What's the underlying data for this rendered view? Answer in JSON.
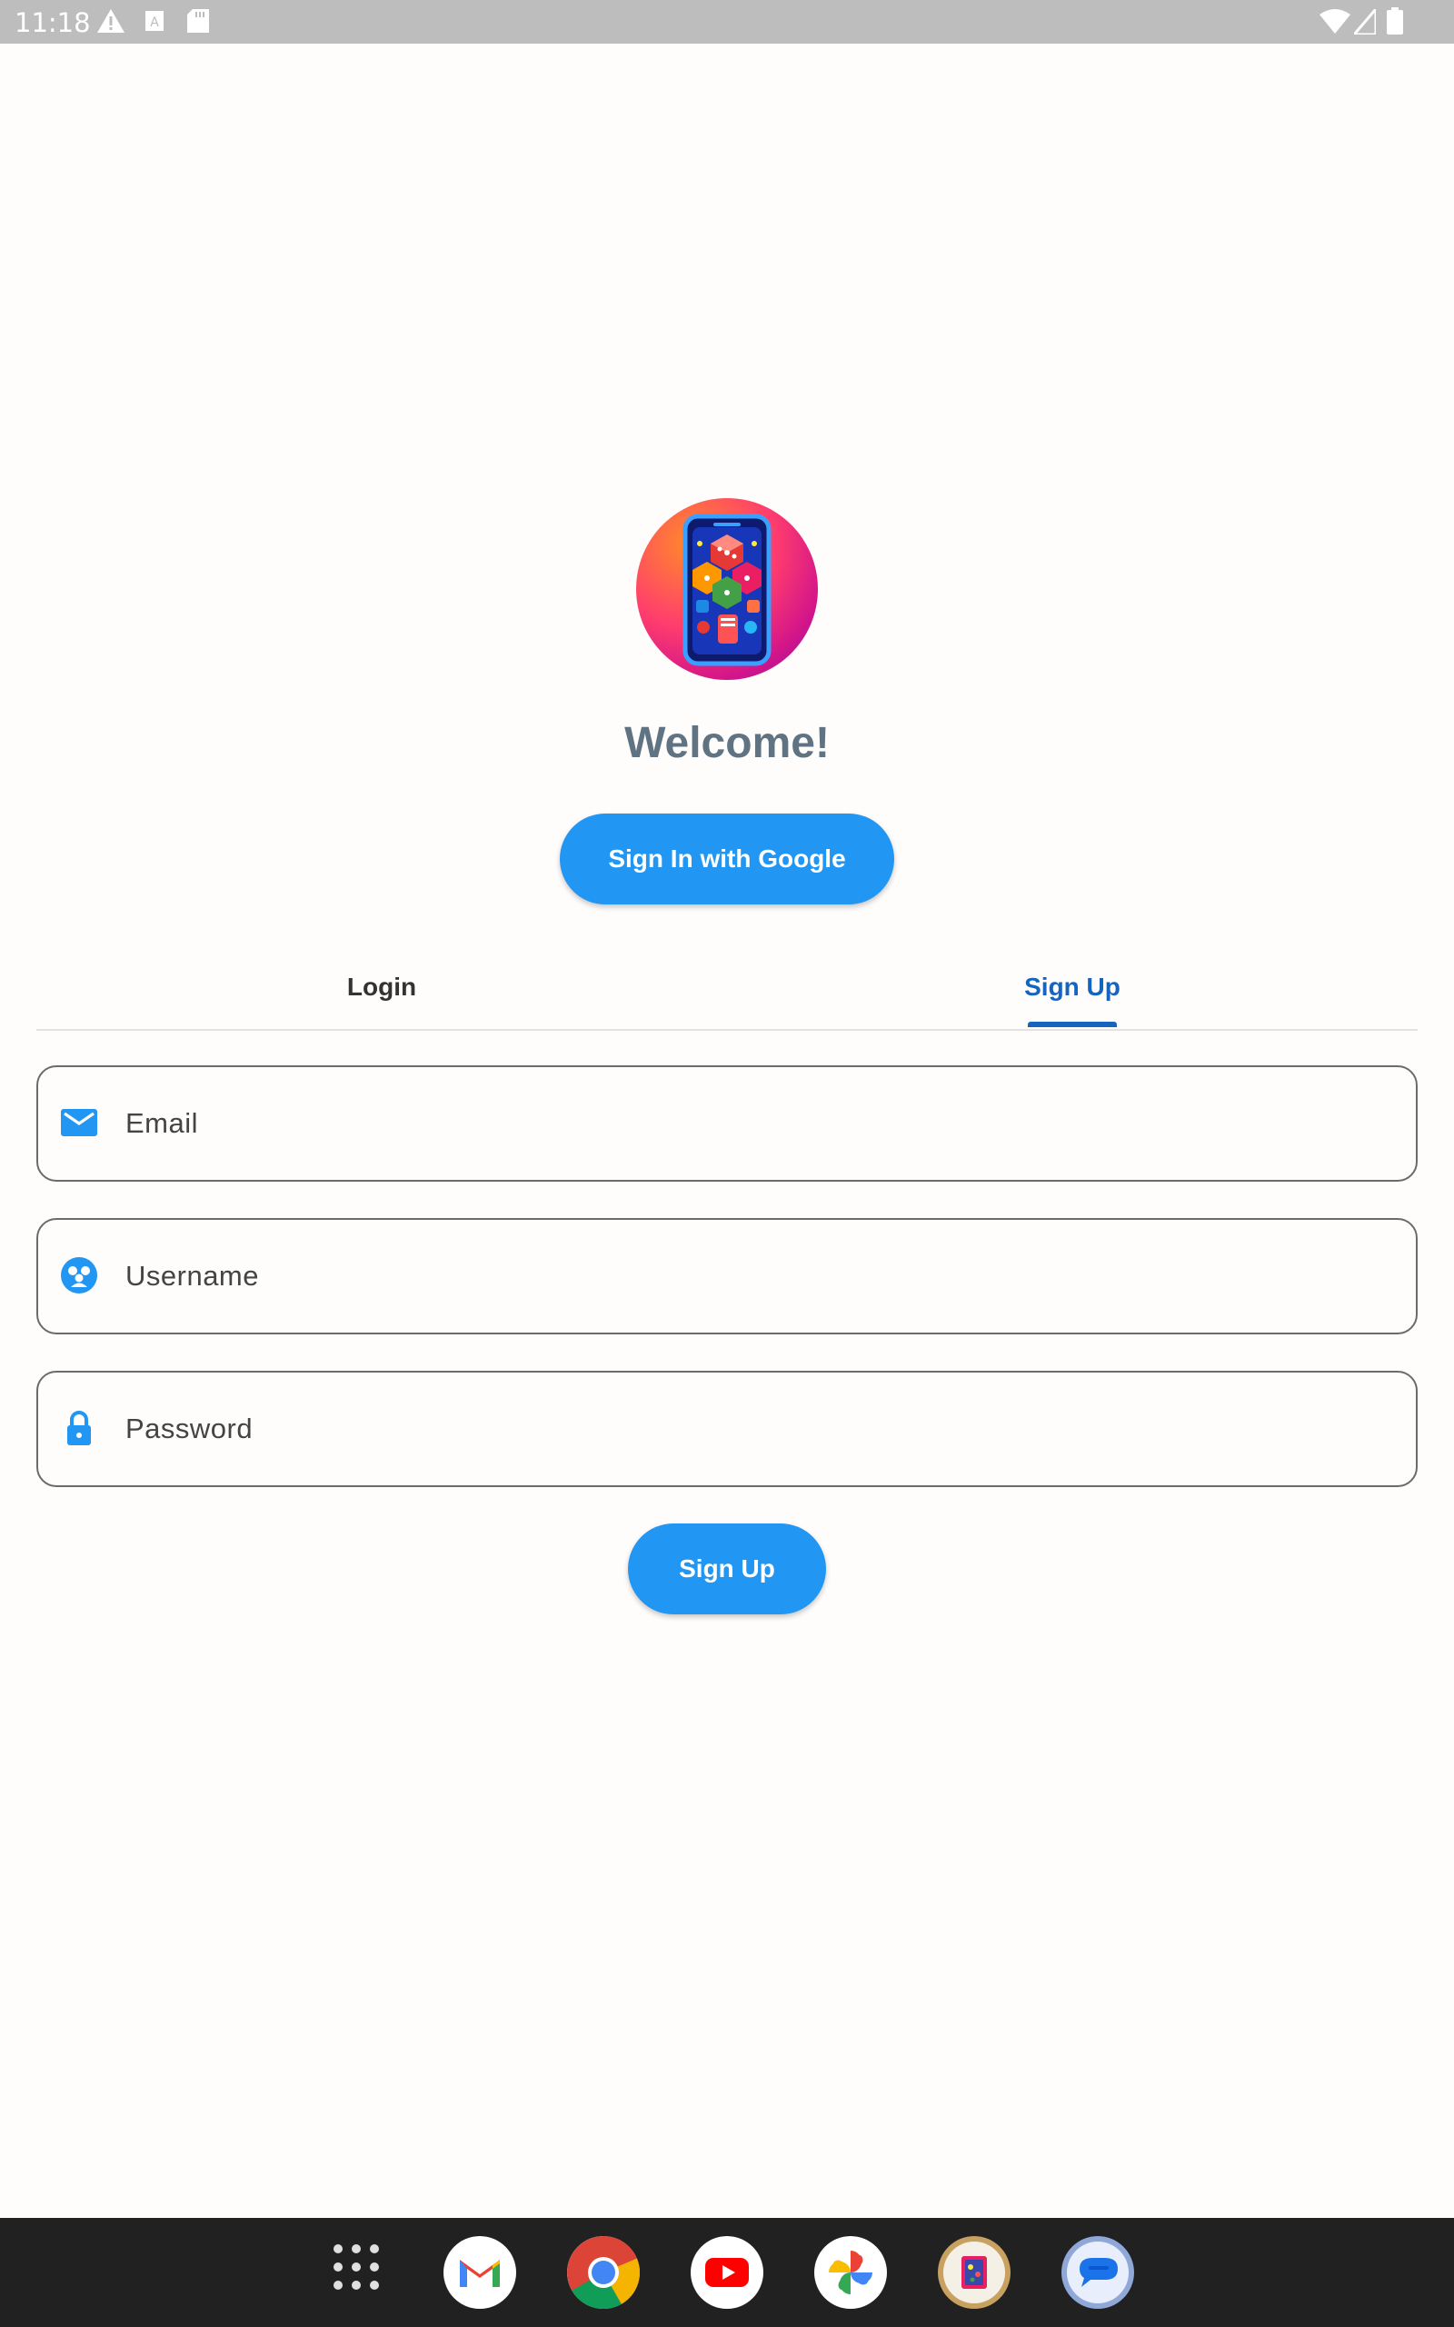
{
  "status_bar": {
    "time": "11:18",
    "icons": [
      "warning-icon",
      "font-a-icon",
      "sd-card-icon",
      "wifi-icon",
      "signal-icon",
      "battery-icon"
    ]
  },
  "app": {
    "logo": "app-logo-phone-dice",
    "welcome": "Welcome!",
    "google_button": "Sign In with Google"
  },
  "tabs": [
    {
      "label": "Login",
      "selected": false
    },
    {
      "label": "Sign Up",
      "selected": true
    }
  ],
  "form": {
    "email_placeholder": "Email",
    "username_placeholder": "Username",
    "password_placeholder": "Password",
    "submit": "Sign Up"
  },
  "dock": {
    "apps": [
      "app-drawer-icon",
      "gmail-icon",
      "chrome-icon",
      "youtube-icon",
      "photos-icon",
      "app-logo-icon",
      "messages-icon"
    ]
  },
  "colors": {
    "accent": "#2196f3",
    "tab_selected": "#1565c0",
    "welcome_text": "#5f7382"
  }
}
